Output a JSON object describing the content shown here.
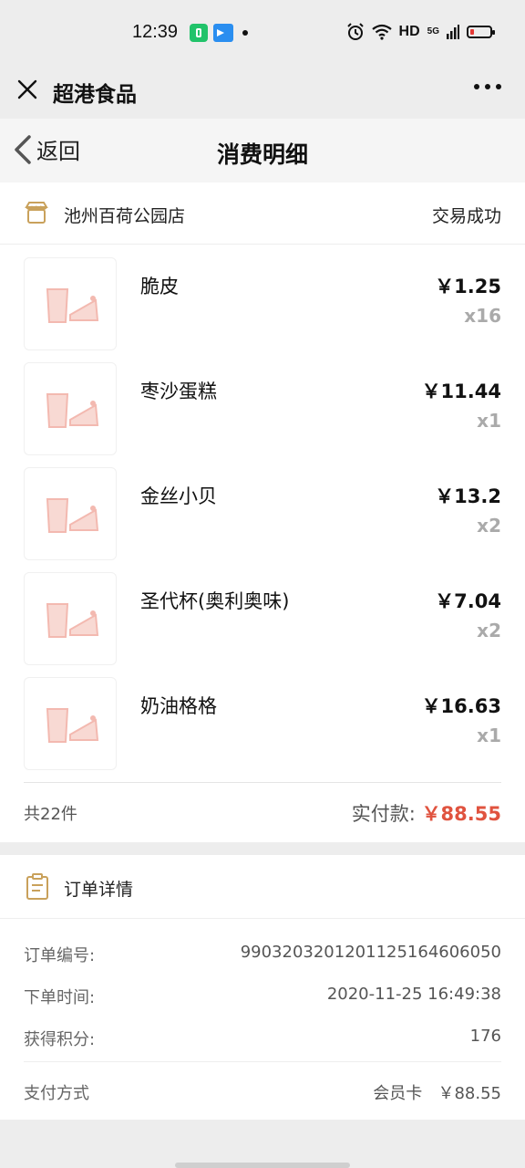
{
  "status_bar": {
    "time": "12:39",
    "network": "HD",
    "signal": "5G",
    "icons": [
      "app-icon-green",
      "app-icon-blue",
      "notification-dot",
      "alarm-icon",
      "wifi-icon",
      "signal-icon",
      "battery-low-icon"
    ]
  },
  "titlebar": {
    "app_name": "超港食品"
  },
  "pagenav": {
    "back_label": "返回",
    "title": "消费明细"
  },
  "store": {
    "name": "池州百荷公园店",
    "status": "交易成功"
  },
  "items": [
    {
      "name": "脆皮",
      "price": "￥1.25",
      "qty": "x16"
    },
    {
      "name": "枣沙蛋糕",
      "price": "￥11.44",
      "qty": "x1"
    },
    {
      "name": "金丝小贝",
      "price": "￥13.2",
      "qty": "x2"
    },
    {
      "name": "圣代杯(奥利奥味)",
      "price": "￥7.04",
      "qty": "x2"
    },
    {
      "name": "奶油格格",
      "price": "￥16.63",
      "qty": "x1"
    }
  ],
  "summary": {
    "count": "共22件",
    "paid_label": "实付款: ",
    "paid_amount": "￥88.55"
  },
  "detail": {
    "title": "订单详情",
    "rows": [
      {
        "label": "订单编号:",
        "value": "990320320120112516460605​0"
      },
      {
        "label": "下单时间:",
        "value": "2020-11-25 16:49:38"
      },
      {
        "label": "获得积分:",
        "value": "176"
      }
    ],
    "payment": {
      "label": "支付方式",
      "value": "会员卡   ￥88.55"
    }
  },
  "colors": {
    "accent_price": "#e0533f",
    "icon_gold": "#c9a15b",
    "thumb_pink": "#f3b9b0"
  }
}
